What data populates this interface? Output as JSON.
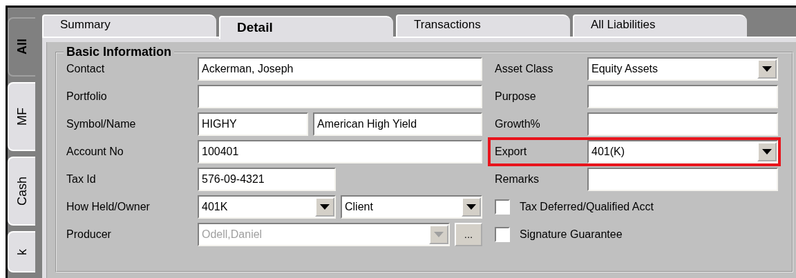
{
  "side_tabs": [
    {
      "label": "All",
      "selected": true
    },
    {
      "label": "MF",
      "selected": false
    },
    {
      "label": "Cash",
      "selected": false
    },
    {
      "label": "k",
      "selected": false
    }
  ],
  "tabs": [
    {
      "label": "Summary",
      "selected": false
    },
    {
      "label": "Detail",
      "selected": true
    },
    {
      "label": "Transactions",
      "selected": false
    },
    {
      "label": "All Liabilities",
      "selected": false
    }
  ],
  "group": {
    "title": "Basic Information",
    "left_rows": [
      {
        "label": "Contact",
        "fields": [
          {
            "kind": "text",
            "value": "Ackerman, Joseph"
          }
        ]
      },
      {
        "label": "Portfolio",
        "fields": [
          {
            "kind": "text"
          }
        ]
      },
      {
        "label": "Symbol/Name",
        "fields": [
          {
            "kind": "text",
            "value": "HIGHY"
          },
          {
            "kind": "text",
            "value": "American High Yield"
          }
        ]
      },
      {
        "label": "Account No",
        "fields": [
          {
            "kind": "text",
            "value": "100401"
          }
        ]
      },
      {
        "label": "Tax Id",
        "fields": [
          {
            "kind": "text",
            "value": "576-09-4321"
          }
        ]
      },
      {
        "label": "How Held/Owner",
        "fields": [
          {
            "kind": "combo",
            "value": "401K",
            "disabled": false
          },
          {
            "kind": "combo",
            "value": "Client",
            "disabled": false
          }
        ]
      },
      {
        "label": "Producer",
        "fields": [
          {
            "kind": "combo",
            "value": "Odell,Daniel",
            "disabled": true
          },
          {
            "kind": "button",
            "value": "..."
          }
        ]
      }
    ],
    "right_rows": [
      {
        "label": "Asset Class",
        "kind": "combo",
        "value": "Equity Assets",
        "highlighted": false
      },
      {
        "label": "Purpose",
        "kind": "text",
        "highlighted": false
      },
      {
        "label": "Growth%",
        "kind": "text",
        "highlighted": false
      },
      {
        "label": "Export",
        "kind": "combo",
        "value": "401(K)",
        "highlighted": true
      },
      {
        "label": "Remarks",
        "kind": "text",
        "highlighted": false
      }
    ],
    "checkboxes": [
      {
        "label": "Tax Deferred/Qualified Acct",
        "checked": false
      },
      {
        "label": "Signature Guarantee",
        "checked": false
      }
    ]
  }
}
